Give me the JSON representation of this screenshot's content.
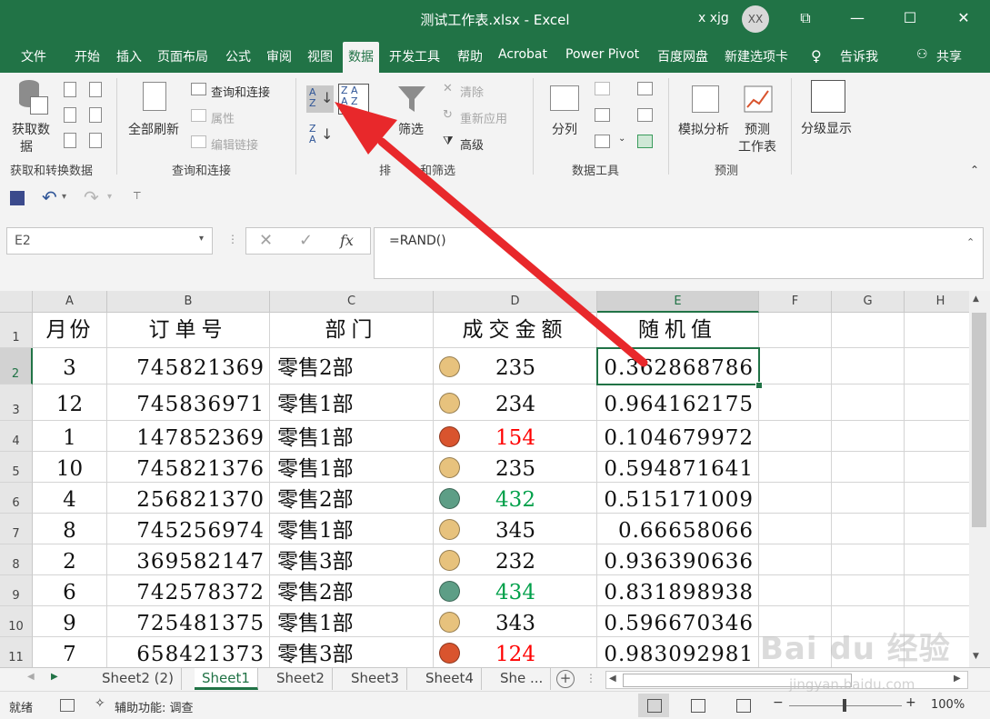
{
  "titlebar": {
    "title": "测试工作表.xlsx  -  Excel",
    "user_name": "x xjg",
    "avatar_initials": "XX",
    "restore_glyph": "⧉",
    "minimize_glyph": "—",
    "maximize_glyph": "☐",
    "close_glyph": "✕"
  },
  "tabs": [
    "文件",
    "开始",
    "插入",
    "页面布局",
    "公式",
    "审阅",
    "视图",
    "数据",
    "开发工具",
    "帮助",
    "Acrobat",
    "Power Pivot",
    "百度网盘",
    "新建选项卡"
  ],
  "active_tab": "数据",
  "tell_me": "告诉我",
  "share": "共享",
  "ribbon": {
    "get_data_line1": "获取数",
    "get_data_line2": "据",
    "group_get_transform": "获取和转换数据",
    "refresh_all": "全部刷新",
    "queries_connections": "查询和连接",
    "properties": "属性",
    "edit_links": "编辑链接",
    "group_queries": "查询和连接",
    "filter": "筛选",
    "clear": "清除",
    "reapply": "重新应用",
    "advanced": "高级",
    "group_sort_filter_visible_left": "排",
    "group_sort_filter_visible_right": "和筛选",
    "text_to_columns": "分列",
    "group_data_tools": "数据工具",
    "what_if": "模拟分析",
    "forecast_sheet_line1": "预测",
    "forecast_sheet_line2": "工作表",
    "group_forecast": "预测",
    "outline": "分级显示"
  },
  "namebox": "E2",
  "formula": "=RAND()",
  "fx_label": "fx",
  "columns": [
    "A",
    "B",
    "C",
    "D",
    "E",
    "F",
    "G",
    "H"
  ],
  "rows": [
    "1",
    "2",
    "3",
    "4",
    "5",
    "6",
    "7",
    "8",
    "9",
    "10",
    "11"
  ],
  "headers": {
    "a": "月份",
    "b": "订单号",
    "c": "部门",
    "d": "成交金额",
    "e": "随机值"
  },
  "data_rows": [
    {
      "month": "3",
      "order": "745821369",
      "dept": "零售2部",
      "amount": "235",
      "icon": "yellow",
      "rand": "0.362868786"
    },
    {
      "month": "12",
      "order": "745836971",
      "dept": "零售1部",
      "amount": "234",
      "icon": "yellow",
      "rand": "0.964162175"
    },
    {
      "month": "1",
      "order": "147852369",
      "dept": "零售1部",
      "amount": "154",
      "icon": "red",
      "rand": "0.104679972"
    },
    {
      "month": "10",
      "order": "745821376",
      "dept": "零售1部",
      "amount": "235",
      "icon": "yellow",
      "rand": "0.594871641"
    },
    {
      "month": "4",
      "order": "256821370",
      "dept": "零售2部",
      "amount": "432",
      "icon": "green",
      "rand": "0.515171009"
    },
    {
      "month": "8",
      "order": "745256974",
      "dept": "零售1部",
      "amount": "345",
      "icon": "yellow",
      "rand": "0.66658066"
    },
    {
      "month": "2",
      "order": "369582147",
      "dept": "零售3部",
      "amount": "232",
      "icon": "yellow",
      "rand": "0.936390636"
    },
    {
      "month": "6",
      "order": "742578372",
      "dept": "零售2部",
      "amount": "434",
      "icon": "green",
      "rand": "0.831898938"
    },
    {
      "month": "9",
      "order": "725481375",
      "dept": "零售1部",
      "amount": "343",
      "icon": "yellow",
      "rand": "0.596670346"
    },
    {
      "month": "7",
      "order": "658421373",
      "dept": "零售3部",
      "amount": "124",
      "icon": "red",
      "rand": "0.983092981"
    }
  ],
  "colors": {
    "excel_green": "#217346",
    "icon_yellow": "#e7c27d",
    "icon_red": "#d9542e",
    "icon_green": "#5d9e86",
    "text_red": "#ff0000",
    "text_green": "#00a04a",
    "arrow_red": "#e8282b"
  },
  "sheets": [
    "Sheet2 (2)",
    "Sheet1",
    "Sheet2",
    "Sheet3",
    "Sheet4",
    "She ..."
  ],
  "active_sheet": "Sheet1",
  "status": {
    "ready": "就绪",
    "accessibility": "辅助功能: 调查",
    "zoom": "100%"
  },
  "watermark": {
    "line1": "Bai du 经验",
    "line2": "jingyan.baidu.com"
  }
}
